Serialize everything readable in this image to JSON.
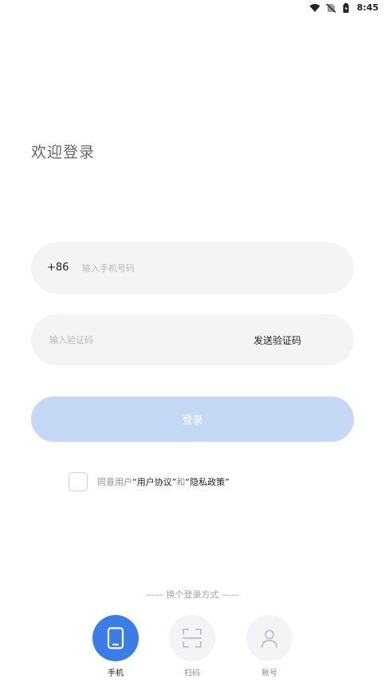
{
  "status_bar": {
    "time": "8:45"
  },
  "welcome": {
    "title": "欢迎登录"
  },
  "phone_field": {
    "country_code": "+86",
    "placeholder": "输入手机号码"
  },
  "code_field": {
    "placeholder": "输入验证码",
    "send_label": "发送验证码"
  },
  "login_button": {
    "label": "登录"
  },
  "agreement": {
    "prefix": "同意用户",
    "user_agreement": "“用户协议”",
    "conjunction": "和",
    "privacy_policy": "“隐私政策”"
  },
  "login_methods": {
    "switch_label": "—— 换个登录方式 ——",
    "items": [
      {
        "label": "手机",
        "icon": "phone-icon",
        "active": true
      },
      {
        "label": "扫码",
        "icon": "scan-icon",
        "active": false
      },
      {
        "label": "账号",
        "icon": "user-icon",
        "active": false
      }
    ]
  },
  "colors": {
    "accent": "#3a7ce8",
    "login_button_disabled": "#c5d9f7",
    "field_background": "#f3f4f6"
  }
}
